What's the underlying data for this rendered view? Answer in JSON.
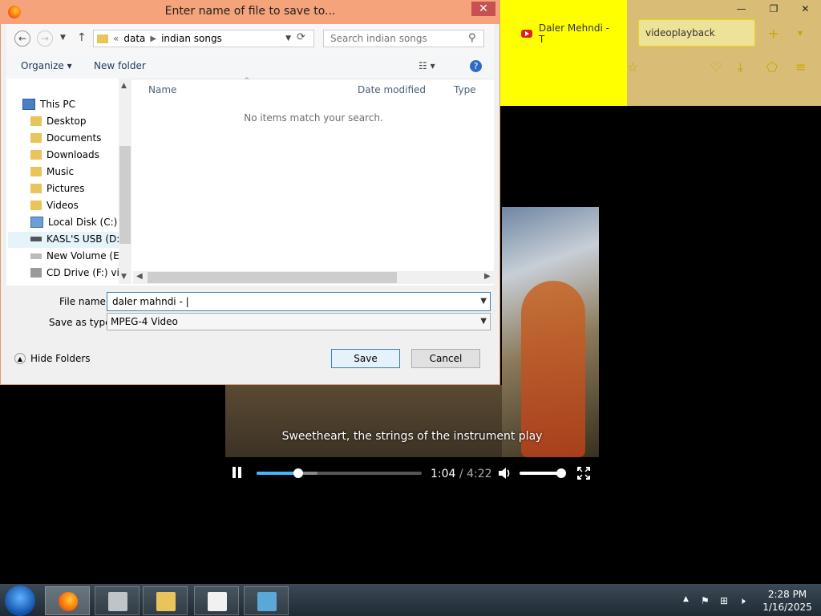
{
  "dialog": {
    "title": "Enter name of file to save to...",
    "close_glyph": "✕",
    "breadcrumb": {
      "prefix": "«",
      "items": [
        "data",
        "indian songs"
      ]
    },
    "search_placeholder": "Search indian songs",
    "organize_label": "Organize ▾",
    "new_folder_label": "New folder",
    "view_label": "☷ ▾",
    "help_glyph": "?",
    "nav_tree": [
      {
        "label": "This PC",
        "icon": "computer-icon"
      },
      {
        "label": "Desktop",
        "icon": "folder-icon"
      },
      {
        "label": "Documents",
        "icon": "folder-icon"
      },
      {
        "label": "Downloads",
        "icon": "folder-icon"
      },
      {
        "label": "Music",
        "icon": "folder-icon"
      },
      {
        "label": "Pictures",
        "icon": "folder-icon"
      },
      {
        "label": "Videos",
        "icon": "folder-icon"
      },
      {
        "label": "Local Disk (C:)",
        "icon": "drive-icon"
      },
      {
        "label": "KASL'S USB (D:)",
        "icon": "usb-drive-icon"
      },
      {
        "label": "New Volume (E:)",
        "icon": "drive-icon"
      },
      {
        "label": "CD Drive (F:) virti",
        "icon": "cd-drive-icon"
      }
    ],
    "columns": [
      "Name",
      "Date modified",
      "Type"
    ],
    "empty_message": "No items match your search.",
    "file_name_label": "File name:",
    "file_name_value": "daler mahndi - |",
    "save_as_type_label": "Save as type:",
    "save_as_type_value": "MPEG-4 Video",
    "hide_folders_label": "Hide Folders",
    "save_label": "Save",
    "cancel_label": "Cancel"
  },
  "browser": {
    "tabs": [
      {
        "label": "Daler Mehndi - T",
        "icon": "youtube-icon"
      },
      {
        "label": "videoplayback"
      }
    ],
    "new_tab_glyph": "+",
    "window_controls": [
      "—",
      "❐",
      "✕"
    ]
  },
  "video": {
    "subtitle": "Sweetheart, the strings of the instrument play",
    "current_time": "1:04",
    "duration": " / 4:22",
    "progress_fraction": 0.25,
    "volume_fraction": 1.0
  },
  "taskbar": {
    "time": "2:28 PM",
    "date": "1/16/2025"
  },
  "colors": {
    "titlebar": "#f4a37a",
    "accent": "#3fb8ff",
    "browser_bg": "#ffff00"
  }
}
